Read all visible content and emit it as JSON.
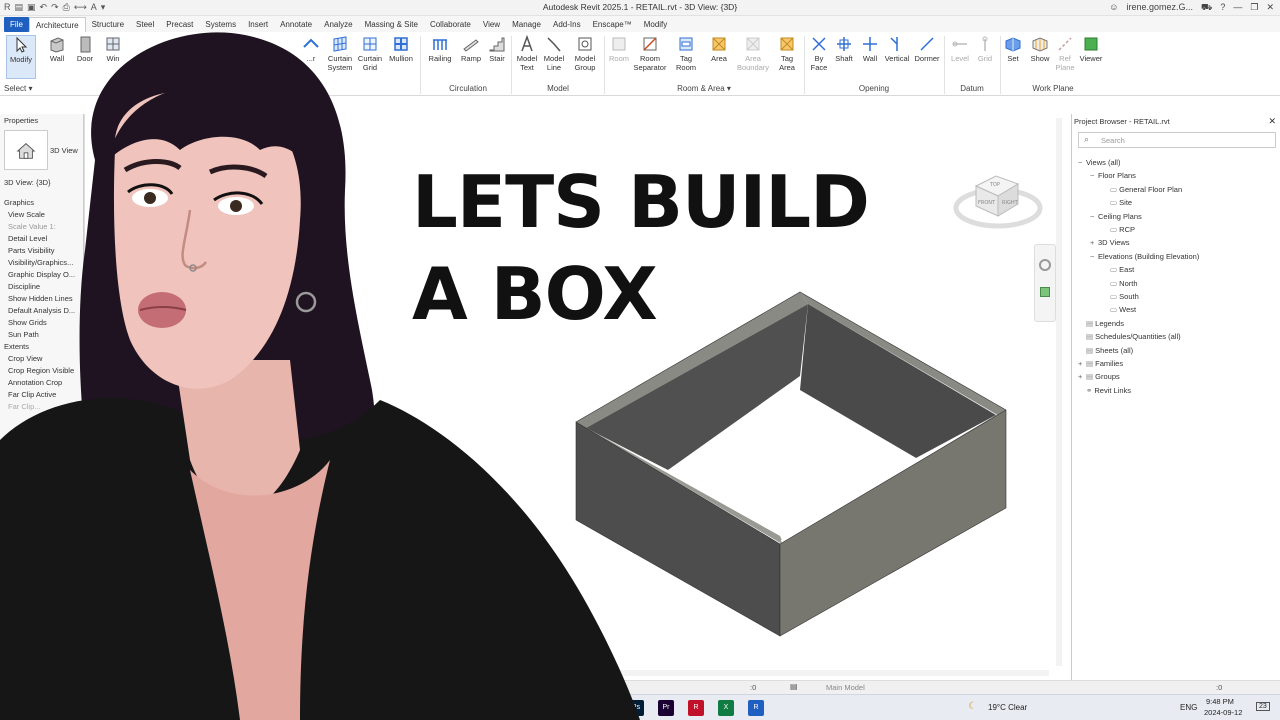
{
  "app": {
    "window_title": "Autodesk Revit 2025.1 - RETAIL.rvt - 3D View: {3D}",
    "user": "irene.gomez.G...",
    "window_controls": [
      "minimize",
      "restore",
      "close"
    ]
  },
  "menu": {
    "tabs": [
      "File",
      "Architecture",
      "Structure",
      "Steel",
      "Precast",
      "Systems",
      "Insert",
      "Annotate",
      "Analyze",
      "Massing & Site",
      "Collaborate",
      "View",
      "Manage",
      "Add-Ins",
      "Enscape™",
      "Modify"
    ]
  },
  "ribbon": {
    "select": {
      "modify": "Modify",
      "select_label": "Select ▾"
    },
    "build": {
      "wall": "Wall",
      "door": "Door",
      "window": "Win"
    },
    "curtain": {
      "roof_short": "...r",
      "curtain_system": "Curtain\nSystem",
      "curtain_grid": "Curtain\nGrid",
      "mullion": "Mullion"
    },
    "circulation": {
      "railing": "Railing",
      "ramp": "Ramp",
      "stair": "Stair",
      "label": "Circulation"
    },
    "model": {
      "model_text": "Model\nText",
      "model_line": "Model\nLine",
      "model_group": "Model\nGroup",
      "label": "Model"
    },
    "room_area": {
      "room": "Room",
      "room_separator": "Room\nSeparator",
      "tag_room": "Tag\nRoom",
      "area": "Area",
      "area_boundary": "Area\nBoundary",
      "tag_area": "Tag\nArea",
      "label": "Room & Area ▾"
    },
    "opening": {
      "by_face": "By\nFace",
      "shaft": "Shaft",
      "wall": "Wall",
      "vertical": "Vertical",
      "dormer": "Dormer",
      "label": "Opening"
    },
    "datum": {
      "level": "Level",
      "grid": "Grid",
      "label": "Datum"
    },
    "work_plane": {
      "set": "Set",
      "show": "Show",
      "ref_plane": "Ref\nPlane",
      "viewer": "Viewer",
      "label": "Work Plane"
    }
  },
  "properties": {
    "title": "Properties",
    "type_name": "3D View",
    "selector": "3D View: {3D}",
    "groups": [
      {
        "name": "Graphics",
        "rows": [
          "View Scale",
          "Scale Value  1:",
          "Detail Level",
          "Parts Visibility",
          "Visibility/Graphics...",
          "Graphic Display O...",
          "Discipline",
          "Show Hidden Lines",
          "Default Analysis D...",
          "Show Grids",
          "Sun Path"
        ]
      },
      {
        "name": "Extents",
        "rows": [
          "Crop View",
          "Crop Region Visible",
          "Annotation Crop",
          "Far Clip Active",
          "Far Clip..."
        ]
      }
    ]
  },
  "overlay": {
    "line1": "LETS BUILD",
    "line2": "A BOX"
  },
  "viewcube": {
    "top": "TOP",
    "front": "FRONT",
    "right": "RIGHT"
  },
  "project_browser": {
    "title": "Project Browser - RETAIL.rvt",
    "search_placeholder": "Search",
    "tree": [
      {
        "label": "Views (all)",
        "level": 0,
        "toggle": "−"
      },
      {
        "label": "Floor Plans",
        "level": 1,
        "toggle": "−"
      },
      {
        "label": "General Floor Plan",
        "level": 2,
        "toggle": ""
      },
      {
        "label": "Site",
        "level": 2,
        "toggle": ""
      },
      {
        "label": "Ceiling Plans",
        "level": 1,
        "toggle": "−"
      },
      {
        "label": "RCP",
        "level": 2,
        "toggle": ""
      },
      {
        "label": "3D Views",
        "level": 1,
        "toggle": "+"
      },
      {
        "label": "Elevations (Building Elevation)",
        "level": 1,
        "toggle": "−"
      },
      {
        "label": "East",
        "level": 2,
        "toggle": ""
      },
      {
        "label": "North",
        "level": 2,
        "toggle": ""
      },
      {
        "label": "South",
        "level": 2,
        "toggle": ""
      },
      {
        "label": "West",
        "level": 2,
        "toggle": ""
      },
      {
        "label": "Legends",
        "level": 0,
        "toggle": ""
      },
      {
        "label": "Schedules/Quantities (all)",
        "level": 0,
        "toggle": ""
      },
      {
        "label": "Sheets (all)",
        "level": 0,
        "toggle": ""
      },
      {
        "label": "Families",
        "level": 0,
        "toggle": "+"
      },
      {
        "label": "Groups",
        "level": 0,
        "toggle": "+"
      },
      {
        "label": "Revit Links",
        "level": 0,
        "toggle": ""
      }
    ]
  },
  "status": {
    "selection_count": ":0",
    "workset": "Main Model",
    "filter_count": ":0"
  },
  "taskbar": {
    "apps": [
      "Ps",
      "Pr",
      "R",
      "X",
      "R"
    ],
    "weather": "19°C  Clear",
    "language": "ENG",
    "time": "9:48 PM",
    "date": "2024-09-12",
    "notifications": "23"
  },
  "colors": {
    "file_tab": "#1f5fbf",
    "accent_blue": "#2f6fd6",
    "box_dark": "#4a4a4a",
    "box_top": "#8a8a84",
    "box_side": "#6f6f68"
  }
}
